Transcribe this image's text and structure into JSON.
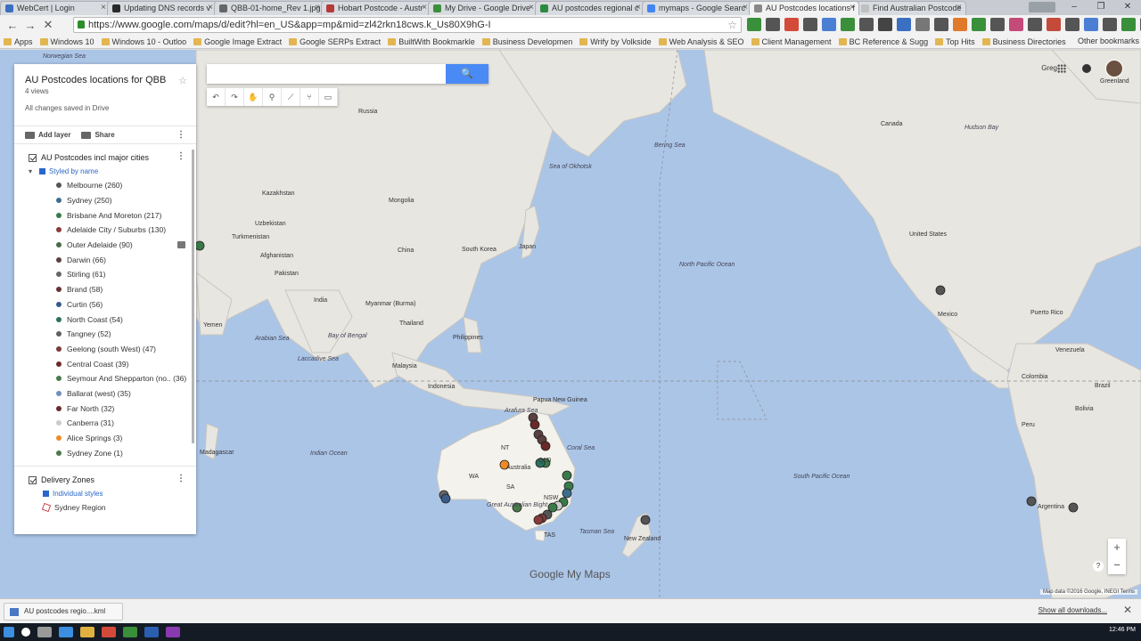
{
  "browser": {
    "tabs": [
      {
        "label": "WebCert | Login",
        "color": "#3b6fc2",
        "active": false
      },
      {
        "label": "Updating DNS records v",
        "color": "#2a2a2a",
        "active": false
      },
      {
        "label": "QBB-01-home_Rev 1.jpg",
        "color": "#666666",
        "active": false
      },
      {
        "label": "Hobart Postcode - Austr",
        "color": "#b53a3a",
        "active": false
      },
      {
        "label": "My Drive - Google Drive",
        "color": "#3b8f3b",
        "active": false
      },
      {
        "label": "AU postcodes regional c",
        "color": "#2c8a40",
        "active": false
      },
      {
        "label": "mymaps - Google Searc",
        "color": "#4285f4",
        "active": false
      },
      {
        "label": "AU Postcodes locations f",
        "color": "#888888",
        "active": true
      },
      {
        "label": "Find Australian Postcode",
        "color": "#c0c0c0",
        "active": false
      }
    ],
    "url": "https://www.google.com/maps/d/edit?hl=en_US&app=mp&mid=zl42rkn18cws.k_Us80X9hG-I",
    "bookmarks": [
      "Apps",
      "Windows 10",
      "Windows 10 - Outloo",
      "Google Image Extract",
      "Google SERPs Extract",
      "BuiltWith Bookmarkle",
      "Business Developmen",
      "Wrify by Volkside",
      "Web Analysis & SEO",
      "Client Management",
      "BC Reference & Sugg",
      "Top Hits",
      "Business Directories"
    ],
    "other_bookmarks": "Other bookmarks",
    "ext_colors": [
      "#3a8f3a",
      "#555555",
      "#d44a3a",
      "#555555",
      "#4a7fd4",
      "#3a8f3a",
      "#555555",
      "#444444",
      "#3b6fc2",
      "#777777",
      "#555555",
      "#e07a2a",
      "#3a8f3a",
      "#555555",
      "#c44a7a",
      "#555555",
      "#c44a3a",
      "#555555",
      "#4a7fd4",
      "#555555",
      "#3a8f3a",
      "#555555"
    ]
  },
  "panel": {
    "title": "AU Postcodes locations for QBB",
    "views": "4 views",
    "saved": "All changes saved in Drive",
    "add_layer": "Add layer",
    "share": "Share",
    "layer1": {
      "title": "AU Postcodes incl major cities",
      "style": "Styled by name",
      "items": [
        {
          "label": "Melbourne (260)",
          "color": "#555555"
        },
        {
          "label": "Sydney (250)",
          "color": "#3c6e8f"
        },
        {
          "label": "Brisbane And Moreton (217)",
          "color": "#3a7a4a"
        },
        {
          "label": "Adelaide City / Suburbs (130)",
          "color": "#8a3a3a"
        },
        {
          "label": "Outer Adelaide (90)",
          "color": "#4a6a4a"
        },
        {
          "label": "Darwin (66)",
          "color": "#5a4040"
        },
        {
          "label": "Stirling (61)",
          "color": "#666666"
        },
        {
          "label": "Brand (58)",
          "color": "#6a3030"
        },
        {
          "label": "Curtin (56)",
          "color": "#3a5a8a"
        },
        {
          "label": "North Coast (54)",
          "color": "#2f6f5f"
        },
        {
          "label": "Tangney (52)",
          "color": "#606060"
        },
        {
          "label": "Geelong (south West) (47)",
          "color": "#7a3a3a"
        },
        {
          "label": "Central Coast (39)",
          "color": "#6a2a2a"
        },
        {
          "label": "Seymour And Shepparton (no.. (36)",
          "color": "#4a7a4a"
        },
        {
          "label": "Ballarat (west) (35)",
          "color": "#6f8fbf"
        },
        {
          "label": "Far North (32)",
          "color": "#6a2a2a"
        },
        {
          "label": "Canberra (31)",
          "color": "#cccccc"
        },
        {
          "label": "Alice Springs (3)",
          "color": "#f08a24"
        },
        {
          "label": "Sydney Zone (1)",
          "color": "#4a7a4a"
        }
      ]
    },
    "layer2": {
      "title": "Delivery Zones",
      "style": "Individual styles",
      "items": [
        {
          "label": "Sydney Region"
        }
      ]
    }
  },
  "map": {
    "search_placeholder": "",
    "user": "Greg",
    "logo": "Google My Maps",
    "attribution": "Map data ©2016 Google, INEGI   Terms",
    "labels": {
      "norwegian_sea": "Norwegian Sea",
      "russia": "Russia",
      "kazakhstan": "Kazakhstan",
      "mongolia": "Mongolia",
      "uzbekistan": "Uzbekistan",
      "turkmenistan": "Turkmenistan",
      "afghanistan": "Afghanistan",
      "pakistan": "Pakistan",
      "china": "China",
      "south_korea": "South Korea",
      "japan": "Japan",
      "india": "India",
      "myanmar": "Myanmar (Burma)",
      "thailand": "Thailand",
      "philippines": "Philippines",
      "malaysia": "Malaysia",
      "indonesia": "Indonesia",
      "papua": "Papua New Guinea",
      "yemen": "Yemen",
      "arabian_sea": "Arabian Sea",
      "bay_of_bengal": "Bay of Bengal",
      "laccadive": "Laccadive Sea",
      "indian_ocean": "Indian Ocean",
      "madagascar": "Madagascar",
      "north_pacific": "North Pacific Ocean",
      "south_pacific": "South Pacific Ocean",
      "bering_sea": "Bering Sea",
      "sea_of_okhotsk": "Sea of Okhotsk",
      "canada": "Canada",
      "hudson_bay": "Hudson Bay",
      "united_states": "United States",
      "mexico": "Mexico",
      "puerto_rico": "Puerto Rico",
      "venezuela": "Venezuela",
      "colombia": "Colombia",
      "peru": "Peru",
      "bolivia": "Bolivia",
      "brazil": "Brazil",
      "argentina": "Argentina",
      "greenland": "Greenland",
      "australia": "Australia",
      "coral_sea": "Coral Sea",
      "tasman_sea": "Tasman Sea",
      "new_zealand": "New Zealand",
      "arafura": "Arafura Sea",
      "great_australian_bight": "Great Australian Bight",
      "nt": "NT",
      "qld": "QLD",
      "wa": "WA",
      "sa": "SA",
      "nsw": "NSW",
      "tas": "TAS"
    }
  },
  "downloads": {
    "item": "AU postcodes regio....kml",
    "show_all": "Show all downloads..."
  },
  "taskbar": {
    "clock": "12:46 PM"
  }
}
